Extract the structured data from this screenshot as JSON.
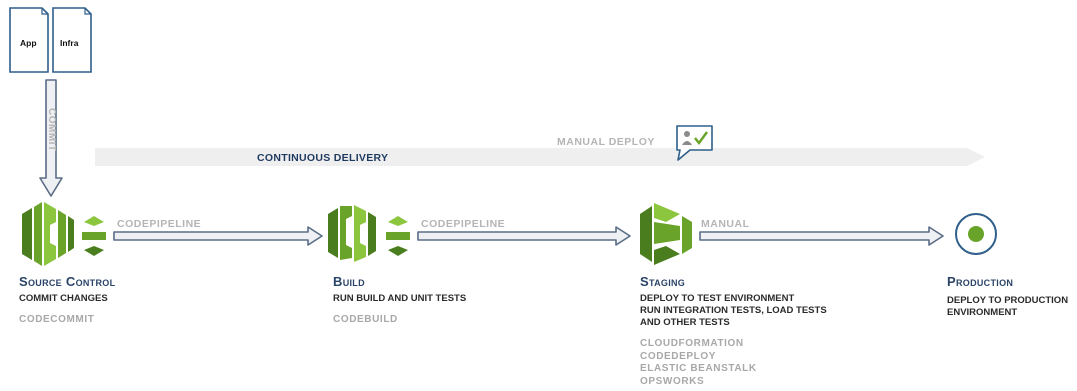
{
  "docs": {
    "app": "App",
    "infra": "Infra"
  },
  "commit_label": "COMMIT",
  "continuous_delivery_label": "CONTINUOUS DELIVERY",
  "manual_deploy_label": "MANUAL DEPLOY",
  "connectors": {
    "pipeline_1": "CODEPIPELINE",
    "pipeline_2": "CODEPIPELINE",
    "manual": "MANUAL"
  },
  "stages": {
    "source": {
      "title": "Source Control",
      "desc": [
        "COMMIT CHANGES"
      ],
      "tools": [
        "CODECOMMIT"
      ]
    },
    "build": {
      "title": "Build",
      "desc": [
        "RUN BUILD AND UNIT TESTS"
      ],
      "tools": [
        "CODEBUILD"
      ]
    },
    "staging": {
      "title": "Staging",
      "desc": [
        "DEPLOY TO TEST ENVIRONMENT",
        "RUN INTEGRATION TESTS, LOAD TESTS",
        "AND OTHER TESTS"
      ],
      "tools": [
        "CLOUDFORMATION",
        "CODEDEPLOY",
        "ELASTIC BEANSTALK",
        "OPSWORKS"
      ]
    },
    "production": {
      "title": "Production",
      "desc": [
        "DEPLOY TO PRODUCTION",
        "ENVIRONMENT"
      ],
      "tools": []
    }
  },
  "icons": {
    "source": "codecommit-icon",
    "pipeline": "codepipeline-icon",
    "build": "codebuild-icon",
    "staging": "beanstalk-icon",
    "production": "production-target-icon",
    "approval": "approval-icon"
  },
  "colors": {
    "aws_green_dark": "#4a7d1e",
    "aws_green": "#6aa32a",
    "aws_green_light": "#8cc63f",
    "arrow_fill": "#eef0f3",
    "arrow_stroke": "#5a6d86",
    "banner": "#efefef",
    "navy": "#2a4468"
  }
}
